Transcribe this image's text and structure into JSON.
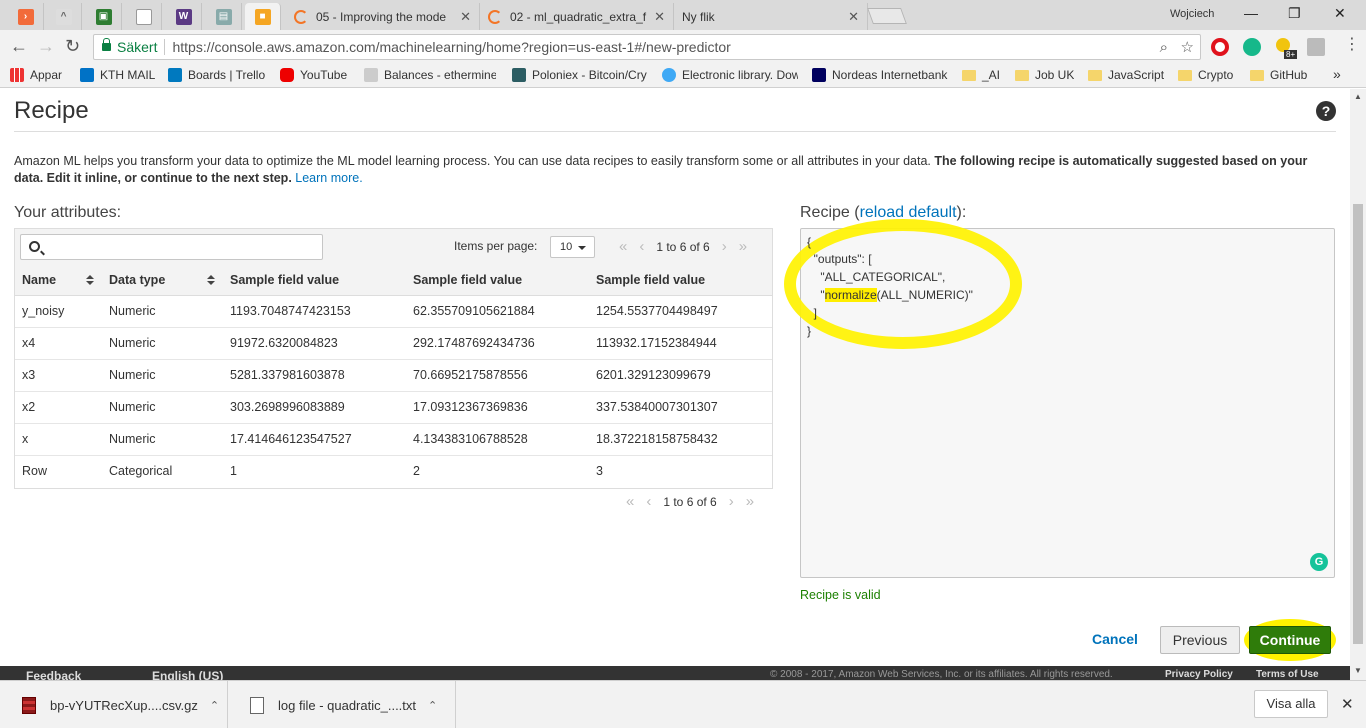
{
  "browser": {
    "tabs": [
      {
        "title": "05 - Improving the mode"
      },
      {
        "title": "02 - ml_quadratic_extra_f"
      },
      {
        "title": "Ny flik"
      }
    ],
    "profile": "Wojciech",
    "window_controls": {
      "minimize": "—",
      "restore": "❐",
      "close": "✕"
    },
    "secure_label": "Säkert",
    "url": "https://console.aws.amazon.com/machinelearning/home?region=us-east-1#/new-predictor",
    "ext_badge": "8+",
    "bookmarks": [
      {
        "label": "Appar"
      },
      {
        "label": "KTH MAIL"
      },
      {
        "label": "Boards | Trello"
      },
      {
        "label": "YouTube"
      },
      {
        "label": "Balances - ethermine"
      },
      {
        "label": "Poloniex - Bitcoin/Cry"
      },
      {
        "label": "Electronic library. Dow"
      },
      {
        "label": "Nordeas Internetbank"
      },
      {
        "label": "_AI"
      },
      {
        "label": "Job UK"
      },
      {
        "label": "JavaScript"
      },
      {
        "label": "Crypto"
      },
      {
        "label": "GitHub"
      }
    ],
    "bookmarks_more": "»"
  },
  "page": {
    "title": "Recipe",
    "help": "?",
    "intro_plain": "Amazon ML helps you transform your data to optimize the ML model learning process. You can use data recipes to easily transform some or all attributes in your data. ",
    "intro_bold": "The following recipe is automatically suggested based on your data. Edit it inline, or continue to the next step.",
    "learn_more": "Learn more."
  },
  "attributes": {
    "title": "Your attributes:",
    "search_placeholder": "",
    "items_per_page_label": "Items per page:",
    "items_per_page_value": "10",
    "pager_text": "1 to 6 of 6",
    "pager_first": "«",
    "pager_prev": "‹",
    "pager_next": "›",
    "pager_last": "»",
    "columns": [
      "Name",
      "Data type",
      "Sample field value",
      "Sample field value",
      "Sample field value"
    ],
    "rows": [
      [
        "y_noisy",
        "Numeric",
        "1193.7048747423153",
        "62.355709105621884",
        "1254.5537704498497"
      ],
      [
        "x4",
        "Numeric",
        "91972.6320084823",
        "292.17487692434736",
        "113932.17152384944"
      ],
      [
        "x3",
        "Numeric",
        "5281.337981603878",
        "70.66952175878556",
        "6201.329123099679"
      ],
      [
        "x2",
        "Numeric",
        "303.2698996083889",
        "17.09312367369836",
        "337.53840007301307"
      ],
      [
        "x",
        "Numeric",
        "17.414646123547527",
        "4.134383106788528",
        "18.372218158758432"
      ],
      [
        "Row",
        "Categorical",
        "1",
        "2",
        "3"
      ]
    ]
  },
  "recipe": {
    "title_prefix": "Recipe (",
    "reload_link": "reload default",
    "title_suffix": "):",
    "code": {
      "l1": "{",
      "l2": "  \"outputs\": [",
      "l3": "    \"ALL_CATEGORICAL\",",
      "l4_pre": "    \"",
      "l4_hl": "normalize",
      "l4_post": "(ALL_NUMERIC)\"",
      "l5": "  ]",
      "l6": "}"
    },
    "grammarly": "G",
    "status": "Recipe is valid"
  },
  "actions": {
    "cancel": "Cancel",
    "previous": "Previous",
    "continue": "Continue"
  },
  "footer": {
    "feedback": "Feedback",
    "language": "English (US)",
    "copyright": "© 2008 - 2017, Amazon Web Services, Inc. or its affiliates. All rights reserved.",
    "privacy": "Privacy Policy",
    "terms": "Terms of Use"
  },
  "downloads": {
    "items": [
      {
        "name": "bp-vYUTRecXup....csv.gz"
      },
      {
        "name": "log file - quadratic_....txt"
      }
    ],
    "chevron": "⌃",
    "show_all": "Visa alla",
    "close": "✕"
  },
  "colors": {
    "accent_link": "#0073bb",
    "continue_green": "#2f7c0a",
    "valid_green": "#1d8102",
    "highlight_yellow": "#fff200"
  }
}
